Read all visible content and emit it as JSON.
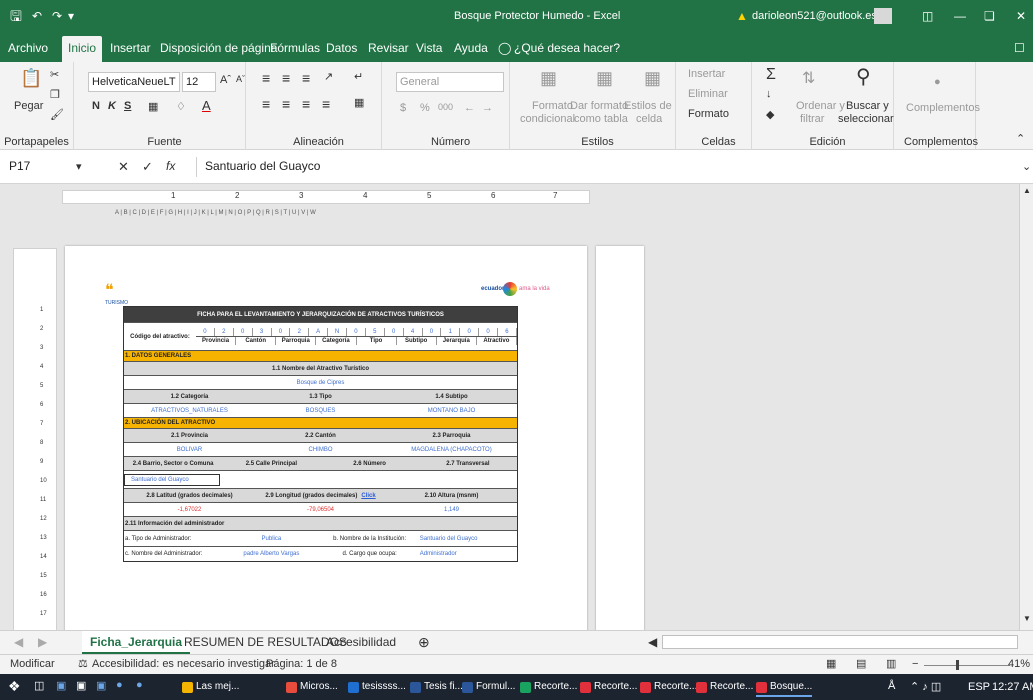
{
  "titlebar": {
    "title": "Bosque Protector Humedo  -  Excel",
    "user": "darioleon521@outlook.es"
  },
  "menu": {
    "tabs": [
      "Archivo",
      "Inicio",
      "Insertar",
      "Disposición de página",
      "Fórmulas",
      "Datos",
      "Revisar",
      "Vista",
      "Ayuda"
    ],
    "tell": "¿Qué desea hacer?"
  },
  "ribbon": {
    "paste": "Pegar",
    "clipboard": "Portapapeles",
    "font": {
      "name": "HelveticaNeueLT Pr",
      "size": "12",
      "bold": "N",
      "italic": "K",
      "underline": "S",
      "label": "Fuente"
    },
    "align_label": "Alineación",
    "number": {
      "format": "General",
      "pct": "%",
      "thousands": "000",
      "label": "Número"
    },
    "styles": {
      "cond": "Formato",
      "cond2": "condicional",
      "table": "Dar formato",
      "table2": "como tabla",
      "cell": "Estilos de",
      "cell2": "celda",
      "label": "Estilos"
    },
    "cells": {
      "insert": "Insertar",
      "delete": "Eliminar",
      "format": "Formato",
      "label": "Celdas"
    },
    "edit": {
      "sort": "Ordenar y",
      "sort2": "filtrar",
      "find": "Buscar y",
      "find2": "seleccionar",
      "label": "Edición"
    },
    "addins": {
      "btn": "Complementos",
      "label": "Complementos"
    }
  },
  "formula": {
    "cell": "P17",
    "fx": "fx",
    "value": "Santuario del Guayco"
  },
  "ruler": {
    "nums": [
      "1",
      "2",
      "3",
      "4",
      "5",
      "6",
      "7"
    ],
    "cols": "A | B | C | D | E | F | G | H | I | J | K | L | M | N | O | P | Q | R | S | T | U | V | W"
  },
  "rows": [
    "1",
    "2",
    "3",
    "4",
    "5",
    "6",
    "7",
    "8",
    "9",
    "10",
    "11",
    "12",
    "13",
    "14",
    "15",
    "16",
    "17"
  ],
  "doc": {
    "logo_left": "TURISMO",
    "logo_right": "ecuador",
    "logo_right2": "ama la vida",
    "title": "FICHA PARA EL LEVANTAMIENTO Y JERARQUIZACIÓN DE ATRACTIVOS TURÍSTICOS",
    "code_label": "Código del atractivo:",
    "code_digits": [
      "0",
      "2",
      "0",
      "3",
      "0",
      "2",
      "A",
      "N",
      "0",
      "5",
      "0",
      "4",
      "0",
      "1",
      "0",
      "0",
      "6"
    ],
    "code_parts": [
      "Provincia",
      "Cantón",
      "Parroquia",
      "Categoría",
      "Tipo",
      "Subtipo",
      "Jerarquía",
      "Atractivo"
    ],
    "s1": "1. DATOS GENERALES",
    "name_label": "1.1 Nombre del Atractivo Turístico",
    "name_value": "Bosque de Cipres",
    "cat_labels": [
      "1.2 Categoría",
      "1.3 Tipo",
      "1.4 Subtipo"
    ],
    "cat_values": [
      "ATRACTIVOS_NATURALES",
      "BOSQUES",
      "MONTANO BAJO"
    ],
    "s2": "2. UBICACIÓN DEL ATRACTIVO",
    "loc_labels": [
      "2.1 Provincia",
      "2.2 Cantón",
      "2.3 Parroquia"
    ],
    "loc_values": [
      "BOLIVAR",
      "CHIMBO",
      "MAGDALENA (CHAPACOTO)"
    ],
    "addr_labels": [
      "2.4 Barrio, Sector o Comuna",
      "2.5 Calle Principal",
      "2.6 Número",
      "2.7 Transversal"
    ],
    "addr_values": [
      "Santuario del Guayco",
      "",
      "",
      ""
    ],
    "coord_labels": [
      "2.8 Latitud (grados decimales)",
      "2.9 Longitud (grados decimales)",
      "2.10 Altura (msnm)"
    ],
    "coord_link": "Click",
    "coord_values": [
      "-1,67022",
      "-79,06504",
      "1,149"
    ],
    "s211": "2.11 Información del administrador",
    "admin": {
      "type_label": "a. Tipo de Administrador:",
      "type_value": "Publica",
      "inst_label": "b. Nombre de la Institución:",
      "inst_value": "Santuario del Guayco",
      "name_label": "c. Nombre del Administrador:",
      "name_value": "padre Alberto Vargas",
      "role_label": "d. Cargo que ocupa:",
      "role_value": "Administrador"
    }
  },
  "sheets": [
    "Ficha_Jerarquia",
    "RESUMEN DE RESULTADOS",
    "Accesibilidad"
  ],
  "status": {
    "mode": "Modificar",
    "access": "Accesibilidad: es necesario investigar",
    "page": "Página: 1 de 8",
    "zoom": "41%"
  },
  "taskbar": {
    "items": [
      "Las mej...",
      "Micros...",
      "tesissss...",
      "Tesis fi...",
      "Formul...",
      "Recorte...",
      "Recorte...",
      "Recorte...",
      "Recorte...",
      "Bosque..."
    ],
    "lang": "ESP",
    "time": "12:27 AM"
  }
}
